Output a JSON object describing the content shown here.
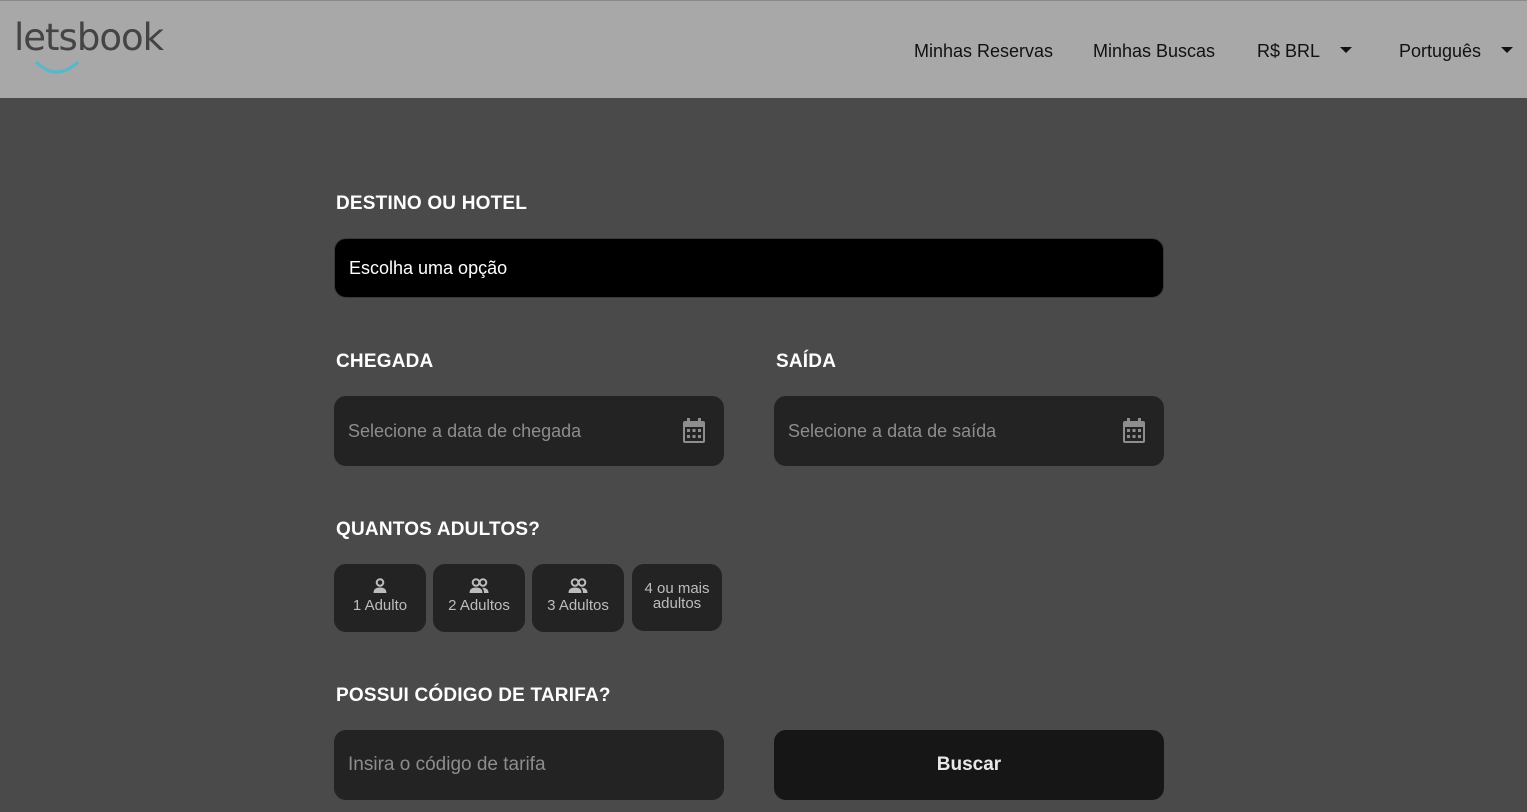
{
  "header": {
    "logo_text": "letsbook",
    "nav": {
      "reservations": "Minhas Reservas",
      "searches": "Minhas Buscas",
      "currency": "R$ BRL",
      "language": "Português"
    }
  },
  "form": {
    "destination": {
      "label": "DESTINO OU HOTEL",
      "value": "Escolha uma opção"
    },
    "checkin": {
      "label": "CHEGADA",
      "placeholder": "Selecione a data de chegada"
    },
    "checkout": {
      "label": "SAÍDA",
      "placeholder": "Selecione a data de saída"
    },
    "adults": {
      "label": "QUANTOS ADULTOS?",
      "options": [
        "1 Adulto",
        "2 Adultos",
        "3 Adultos",
        "4 ou mais adultos"
      ]
    },
    "rate_code": {
      "label": "POSSUI CÓDIGO DE TARIFA?",
      "placeholder": "Insira o código de tarifa"
    },
    "search_button": "Buscar"
  },
  "colors": {
    "header_bg": "#a8a8a8",
    "page_bg": "#4a4a4a",
    "field_bg": "#232323",
    "logo_accent": "#5bb6c9"
  },
  "icons": {
    "calendar": "calendar-icon",
    "single_person": "person-icon",
    "group": "people-icon"
  }
}
